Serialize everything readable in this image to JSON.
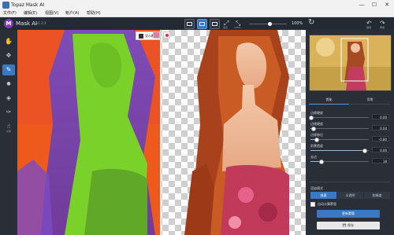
{
  "window": {
    "title": "Topaz Mask AI",
    "minimize": "—",
    "maximize": "☐",
    "close": "✕"
  },
  "menu": [
    "文件(F)",
    "编辑(E)",
    "视图(V)",
    "帐户(A)",
    "帮助(H)"
  ],
  "app": {
    "logo_letter": "M",
    "name": "Mask AI",
    "version": "v1.3.3"
  },
  "toolbar": {
    "fit_label": "适合",
    "zoom_100_label": "100%",
    "zoom_value": "100%",
    "undo_label": "撤消",
    "redo_label": "重做",
    "zoom_slider_position": 0.55
  },
  "canvas": {
    "overlay_label": "显示覆盖"
  },
  "tools": [
    "全部"
  ],
  "right_panel": {
    "tabs": [
      "优化",
      "背景"
    ],
    "sliders": [
      {
        "label": "边缘硬度",
        "value": "0.00",
        "level": 0.0
      },
      {
        "label": "边缘硬度",
        "value": "0.04",
        "level": 0.04
      },
      {
        "label": "边缘移位",
        "value": "-0.80",
        "level": 0.1
      },
      {
        "label": "前景透度",
        "value": "0.00",
        "level": 0.92
      },
      {
        "label": "去边",
        "value": "18",
        "level": 0.18
      }
    ],
    "mode_label": "渲染模式",
    "modes": [
      "快速",
      "半透明",
      "较精度"
    ],
    "auto_label": "自动计算蒙版",
    "update_button": "更新蒙版",
    "save_button": "保存"
  },
  "colors": {
    "accent": "#3b78c4",
    "mask_green": "#79d12a",
    "mask_purple": "#6a4cc4",
    "mask_red": "#ee5a1c"
  }
}
